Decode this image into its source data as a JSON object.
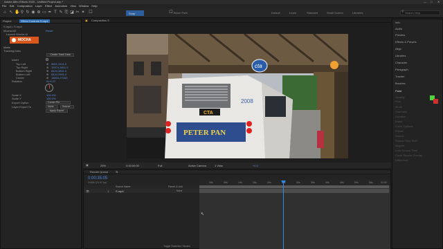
{
  "app": {
    "title": "Adobe After Effects 2020 - Untitled Project.aep *",
    "window_controls": [
      "—",
      "□",
      "✕"
    ]
  },
  "menu": [
    "File",
    "Edit",
    "Composition",
    "Layer",
    "Effect",
    "Animation",
    "View",
    "Window",
    "Help"
  ],
  "toolbar": {
    "snapping_label": "Snap",
    "brush_path_label": "Brush Path",
    "workspaces": [
      "Default",
      "Learn",
      "Standard",
      "Small Screen",
      "Libraries"
    ],
    "search_placeholder": "Search Help"
  },
  "left_panel": {
    "tabs": [
      "Project",
      "Effect Controls S.mp4"
    ],
    "layer_path": "S.mp4 • S.mp4",
    "effect_name": "Mocha AE",
    "reset_label": "Reset",
    "launch_label": "Launch Mocha UI",
    "logo_text": "MOCHA",
    "sections": [
      "Matte",
      "Tracking Data"
    ],
    "create_button": "Create Track Data",
    "fields": [
      {
        "label": "Insert",
        "value": ""
      },
      {
        "label": "Top Left",
        "value": "9601,2441.0"
      },
      {
        "label": "Top Right",
        "value": "19974,3841.0"
      },
      {
        "label": "Bottom Right",
        "value": "8424,3841.0"
      },
      {
        "label": "Bottom Left",
        "value": "8424,2901.0"
      },
      {
        "label": "Center",
        "value": "18816,27463"
      },
      {
        "label": "Rotation",
        "value": "0x+0.0°"
      }
    ],
    "scale_x_label": "Scale X",
    "scale_x_value": "100.0%",
    "scale_y_label": "Scale Y",
    "scale_y_value": "100.0%",
    "export_option_label": "Export Option",
    "export_option_value": "Corner Pin",
    "layer_export_label": "Layer Export To",
    "layer_export_value": "None",
    "source_label": "Source",
    "apply_export_button": "Apply Export"
  },
  "comp_panel": {
    "tab": "Composition S",
    "zoom": "25%",
    "timecode": "0:00:00:00",
    "resolution": "Full",
    "camera": "Active Camera",
    "views": "1 View",
    "exposure": "+0.0"
  },
  "timeline": {
    "tabs": [
      "Render Queue",
      "S"
    ],
    "timecode": "0:00:35:05",
    "fps_info": "00885 (25.00 fps)",
    "column_header": "Source Name",
    "layer_number": "1",
    "layer_name": "S.mp4",
    "ticks": [
      "00s",
      "05s",
      "10s",
      "15s",
      "20s",
      "25s",
      "30s",
      "35s",
      "40s",
      "45s",
      "50s",
      "55s",
      "01:00"
    ],
    "toggle_label": "Toggle Switches / Modes",
    "parent_header": "Parent & Link",
    "parent_value": "None"
  },
  "right_panel": {
    "items": [
      "Info",
      "Audio",
      "Preview",
      "Effects & Presets",
      "Align",
      "Libraries",
      "Character",
      "Paragraph",
      "Tracker",
      "Brushes",
      "Paint"
    ],
    "paint_fields": [
      "Opacity",
      "Flow",
      "Mode",
      "Channels",
      "Duration",
      "Erase",
      "Clone Options",
      "Preset",
      "Source",
      "Source Time Shift",
      "Aligned",
      "Lock Source Time",
      "Clone Source Overlay",
      "Difference"
    ],
    "accent_colors": {
      "fg": "#51d23f",
      "bg": "#d12f2f"
    }
  },
  "photo": {
    "sign_text": "CTA",
    "bus_sign": "CTA",
    "ad_text": "PETER PAN",
    "bus_number": "2008",
    "logo_text": "cta"
  },
  "colors": {
    "accent_blue": "#2d8ceb",
    "value_blue": "#5b8ad8",
    "timeline_bar": "#4d4d4d"
  }
}
